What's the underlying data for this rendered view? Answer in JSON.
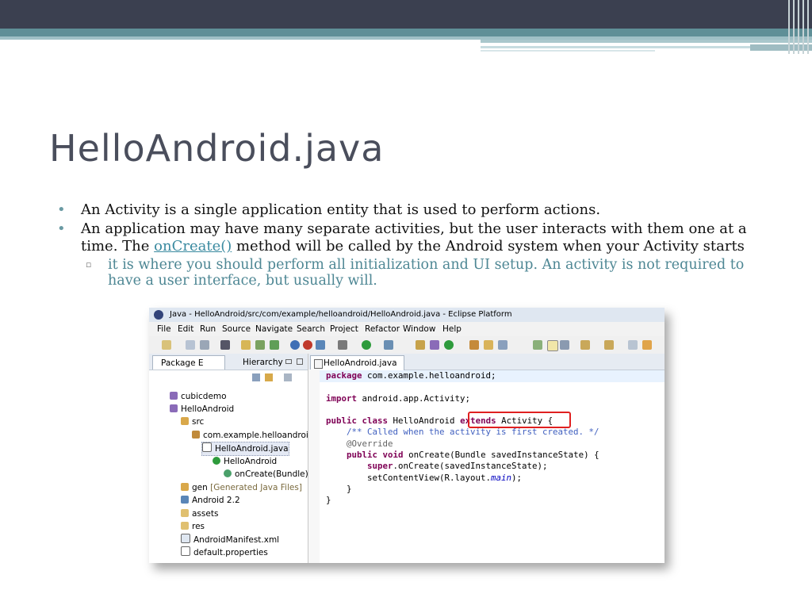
{
  "slide": {
    "title": "HelloAndroid.java",
    "bullet_1": "An Activity is a single application entity that is used to perform actions.",
    "bullet_2_prefix": "An application may have many separate activities, but the user interacts with them one at a time. The ",
    "bullet_2_link": "onCreate()",
    "bullet_2_suffix": " method will be called by the Android system when your Activity starts",
    "sub_bullet": "it is where you should perform all initialization and UI setup. An activity is not required to have a user interface, but usually will.",
    "bullet_glyph": "•",
    "sub_glyph": "▫"
  },
  "eclipse": {
    "window_title": "Java - HelloAndroid/src/com/example/helloandroid/HelloAndroid.java - Eclipse Platform",
    "menus": [
      "File",
      "Edit",
      "Run",
      "Source",
      "Navigate",
      "Search",
      "Project",
      "Refactor",
      "Window",
      "Help"
    ],
    "left_tabs": [
      "Package E",
      "Hierarchy"
    ],
    "tree": [
      {
        "label": "cubicdemo"
      },
      {
        "label": "HelloAndroid"
      },
      {
        "label": "src"
      },
      {
        "label": "com.example.helloandroid"
      },
      {
        "label": "HelloAndroid.java"
      },
      {
        "label": "HelloAndroid"
      },
      {
        "label": "onCreate(Bundle)"
      },
      {
        "label": "gen",
        "extra": "[Generated Java Files]"
      },
      {
        "label": "Android 2.2"
      },
      {
        "label": "assets"
      },
      {
        "label": "res"
      },
      {
        "label": "AndroidManifest.xml"
      },
      {
        "label": "default.properties"
      }
    ],
    "editor_tab": "HelloAndroid.java",
    "code": {
      "l1_kw": "package",
      "l1_rest": " com.example.helloandroid;",
      "l2_kw": "import",
      "l2_rest": " android.app.Activity;",
      "l3_kw1": "public",
      "l3_kw2": "class",
      "l3_name": " HelloAndroid ",
      "l3_kw3": "extends",
      "l3_rest": " Activity {",
      "l4_comment": "/** Called when the activity is first created. */",
      "l5_annot": "@Override",
      "l6_kw1": "public",
      "l6_kw2": "void",
      "l6_rest": " onCreate(Bundle savedInstanceState) {",
      "l7_kw": "super",
      "l7_rest": ".onCreate(savedInstanceState);",
      "l8_pre": "setContentView(R.layout.",
      "l8_it": "main",
      "l8_post": ");",
      "l9": "}",
      "l10": "}"
    }
  }
}
